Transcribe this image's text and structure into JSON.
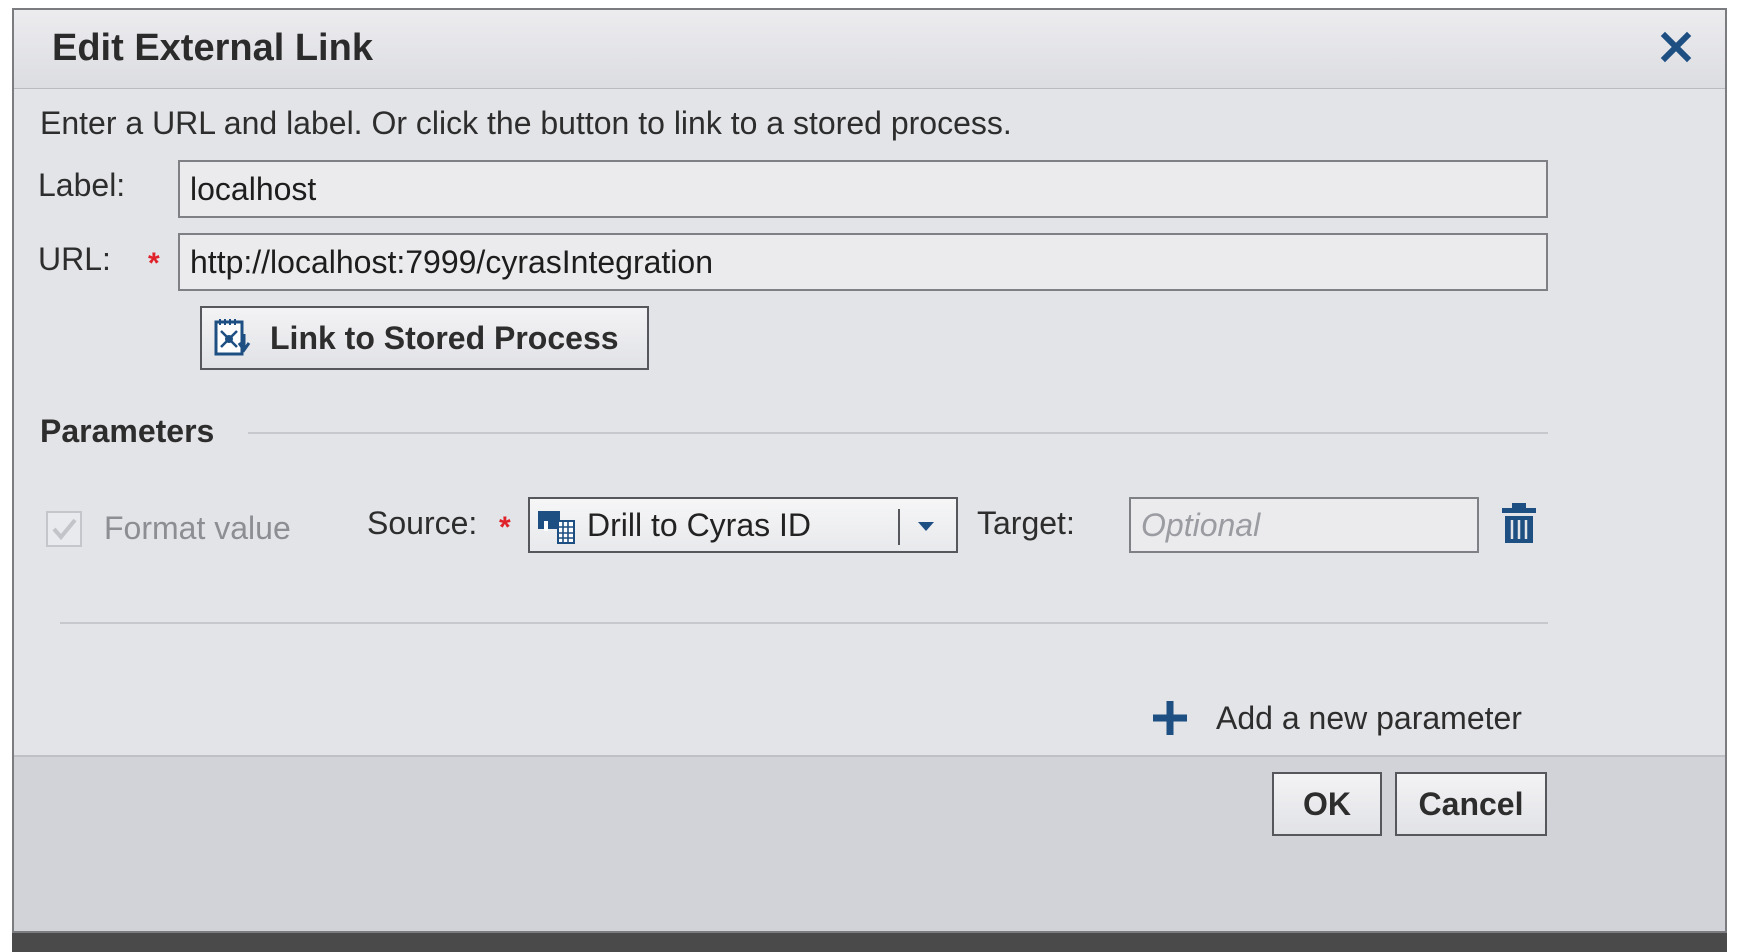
{
  "dialog": {
    "title": "Edit External Link",
    "intro": "Enter a URL and label.  Or click the button to link to a stored process.",
    "label_field": {
      "label": "Label:",
      "value": "localhost"
    },
    "url_field": {
      "label": "URL:",
      "required_mark": "*",
      "value": "http://localhost:7999/cyrasIntegration"
    },
    "stored_process_button": "Link to Stored Process",
    "parameters": {
      "section_title": "Parameters",
      "format_value": {
        "label": "Format value",
        "checked": true,
        "disabled": true
      },
      "source": {
        "label": "Source:",
        "required_mark": "*",
        "selected": "Drill to Cyras ID"
      },
      "target": {
        "label": "Target:",
        "placeholder": "Optional",
        "value": ""
      },
      "add_label": "Add a new parameter"
    },
    "buttons": {
      "ok": "OK",
      "cancel": "Cancel"
    }
  },
  "icons": {
    "close": "close-icon",
    "stored_process": "stored-process-icon",
    "source": "data-source-icon",
    "dropdown": "chevron-down-icon",
    "delete": "trash-icon",
    "add": "plus-icon"
  },
  "colors": {
    "accent": "#1d4f82",
    "required": "#e0232b",
    "dialog_bg": "#e3e4e8",
    "footer_bg": "#d1d3d8"
  }
}
